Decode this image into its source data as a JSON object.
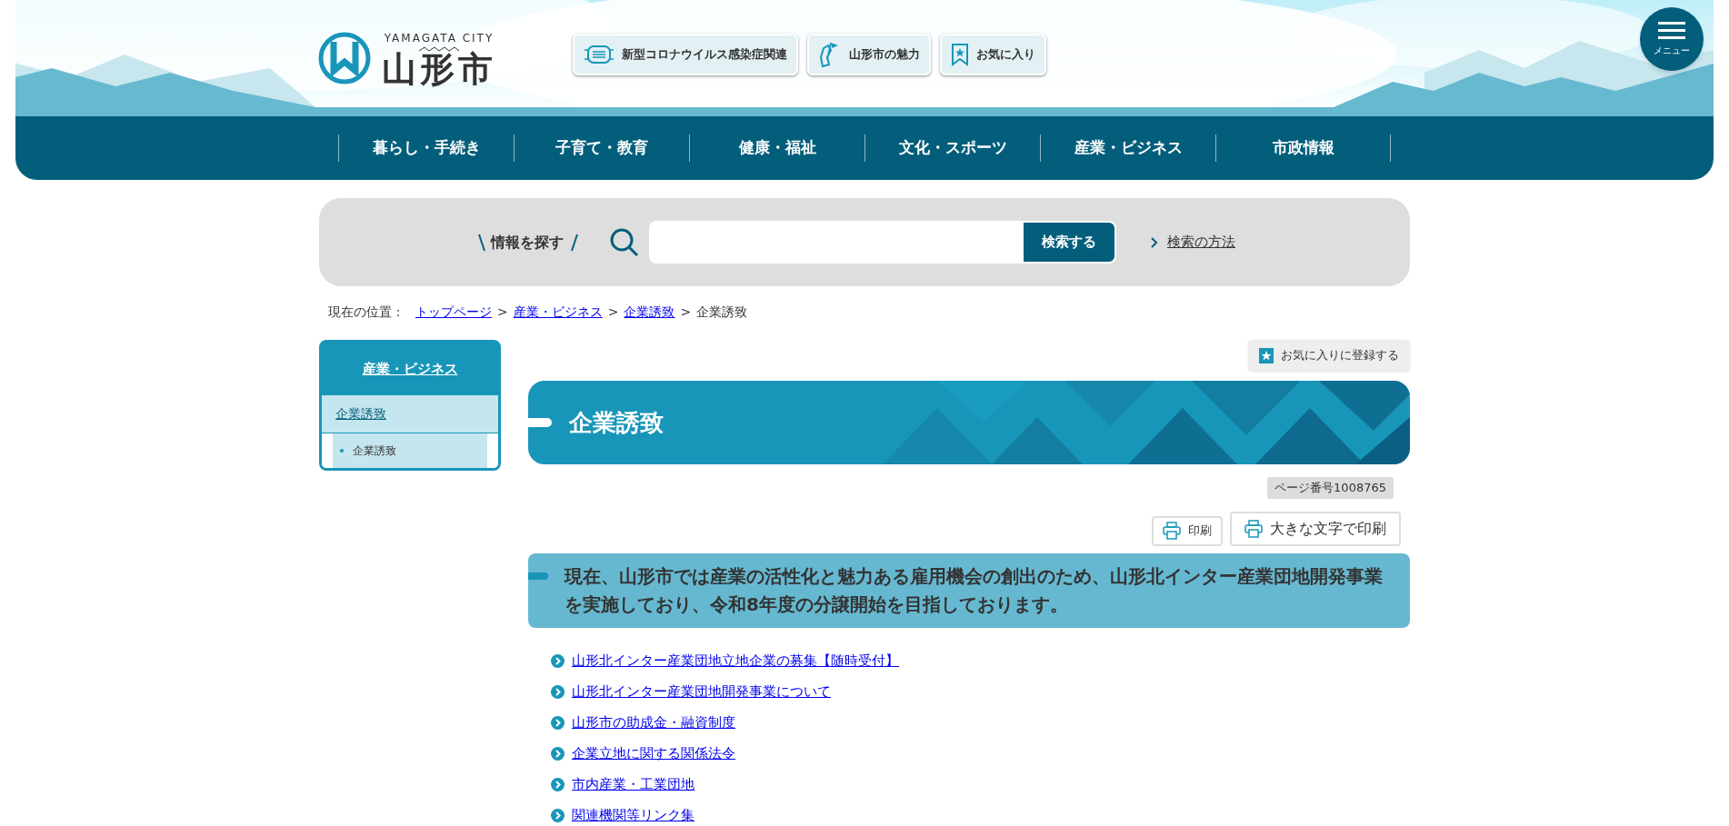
{
  "header": {
    "logo_subtitle": "YAMAGATA CITY",
    "logo_text": "山形市",
    "buttons": [
      {
        "label": "新型コロナウイルス感染症関連",
        "kind": "mask"
      },
      {
        "label": "山形市の魅力",
        "kind": "map"
      },
      {
        "label": "お気に入り",
        "kind": "bookmark"
      }
    ],
    "menu_button": "メニュー"
  },
  "nav": [
    "暮らし・手続き",
    "子育て・教育",
    "健康・福祉",
    "文化・スポーツ",
    "産業・ビジネス",
    "市政情報"
  ],
  "search": {
    "label": "情報を探す",
    "button": "検索する",
    "help_link": "検索の方法"
  },
  "breadcrumb": {
    "label": "現在の位置：",
    "links": [
      "トップページ",
      "産業・ビジネス",
      "企業誘致"
    ],
    "separators": [
      ">",
      ">",
      ">"
    ],
    "current": "企業誘致"
  },
  "sidebar": {
    "heading": "産業・ビジネス",
    "items": [
      {
        "label": "企業誘致",
        "children": [
          {
            "label": "企業誘致"
          }
        ]
      }
    ]
  },
  "favorite_button": "お気に入りに登録する",
  "page_title": "企業誘致",
  "page_number": "ページ番号1008765",
  "print_buttons": [
    "印刷",
    "大きな文字で印刷"
  ],
  "lead": "現在、山形市では産業の活性化と魅力ある雇用機会の創出のため、山形北インター産業団地開発事業を実施しており、令和8年度の分譲開始を目指しております。",
  "links": [
    "山形北インター産業団地立地企業の募集【随時受付】",
    "山形北インター産業団地開発事業について",
    "山形市の助成金・融資制度",
    "企業立地に関する関係法令",
    "市内産業・工業団地",
    "関連機関等リンク集"
  ]
}
